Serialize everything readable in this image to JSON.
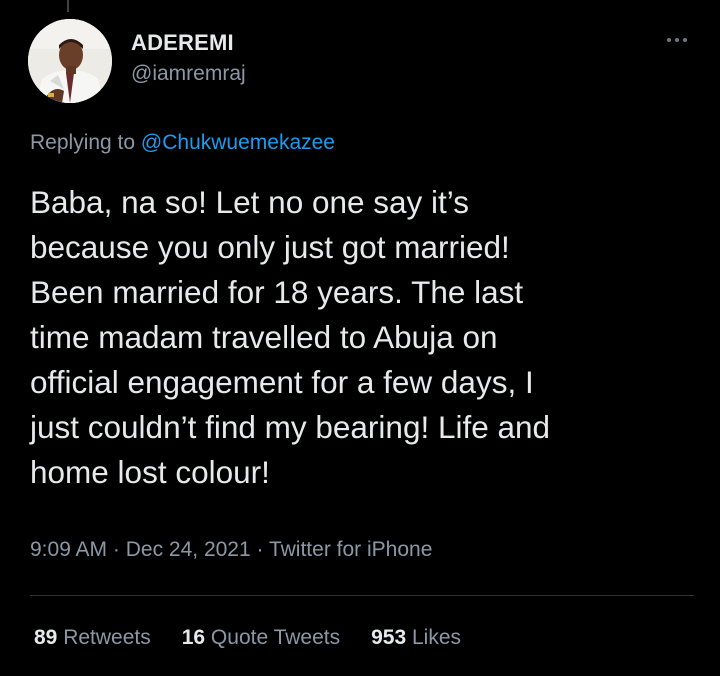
{
  "author": {
    "display_name": "ADEREMI",
    "handle": "@iamremraj",
    "avatar_icon": "profile-photo"
  },
  "reply": {
    "prefix": "Replying to ",
    "mention": "@Chukwuemekazee"
  },
  "tweet": {
    "text": "Baba, na so! Let no one say it’s\nbecause you only just got married!\nBeen married for 18 years. The last\ntime madam travelled to Abuja on\nofficial engagement for a few days, I\njust couldn’t find my bearing! Life and\nhome lost colour!"
  },
  "meta": {
    "time": "9:09 AM",
    "separator": " · ",
    "date": "Dec 24, 2021",
    "source": "Twitter for iPhone"
  },
  "stats": {
    "retweets_count": "89",
    "retweets_label": " Retweets",
    "quotes_count": "16",
    "quotes_label": " Quote Tweets",
    "likes_count": "953",
    "likes_label": " Likes"
  },
  "colors": {
    "background": "#000000",
    "text_primary": "#e7e9ea",
    "text_secondary": "#8b98a5",
    "link": "#1d9bf0",
    "divider": "#2f3336"
  },
  "icons": {
    "more": "more-horizontal-icon"
  }
}
